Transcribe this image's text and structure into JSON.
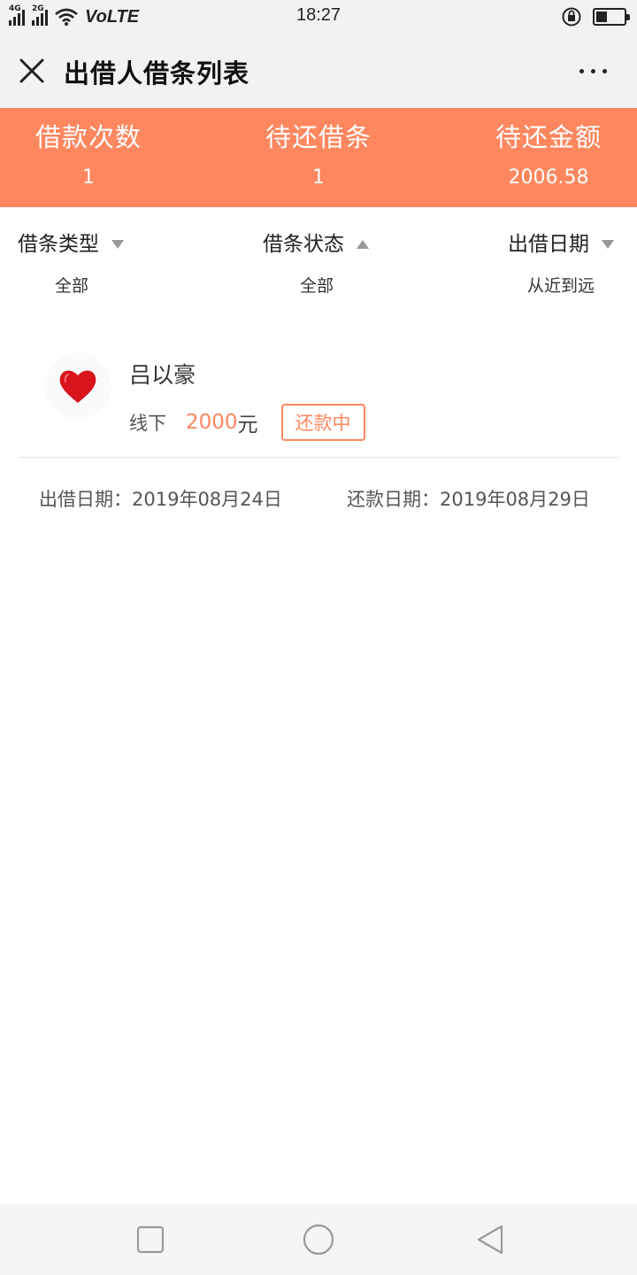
{
  "status_bar": {
    "network_1": "4G",
    "network_2": "2G",
    "carrier_label": "VoLTE",
    "time": "18:27",
    "battery_level": 0.4,
    "icons": [
      "signal-icon",
      "wifi-icon",
      "rotation-lock-icon",
      "battery-icon"
    ]
  },
  "header": {
    "title": "出借人借条列表",
    "close_icon": "close-icon",
    "more_icon": "more-icon"
  },
  "summary": {
    "background_color": "#ff875f",
    "items": [
      {
        "label": "借款次数",
        "value": "1"
      },
      {
        "label": "待还借条",
        "value": "1"
      },
      {
        "label": "待还金额",
        "value": "2006.58"
      }
    ]
  },
  "filters": [
    {
      "label": "借条类型",
      "value": "全部",
      "arrow": "down"
    },
    {
      "label": "借条状态",
      "value": "全部",
      "arrow": "up"
    },
    {
      "label": "出借日期",
      "value": "从近到远",
      "arrow": "down"
    }
  ],
  "loans": [
    {
      "name": "吕以豪",
      "mode": "线下",
      "amount": "2000",
      "unit": "元",
      "status": "还款中",
      "lend_date": "出借日期：2019年08月24日",
      "repay_date": "还款日期：2019年08月29日",
      "avatar_icon": "heart-icon"
    }
  ],
  "colors": {
    "accent": "#ff875f"
  },
  "nav_bar": {
    "icons": [
      "recents-icon",
      "home-icon",
      "back-icon"
    ]
  }
}
